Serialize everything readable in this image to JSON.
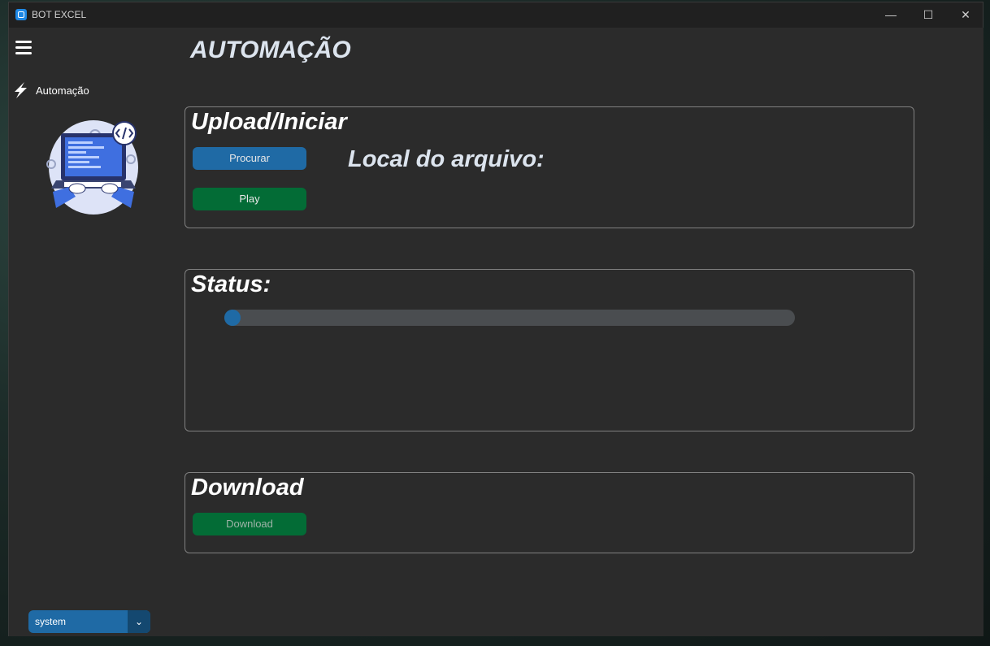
{
  "window": {
    "title": "BOT EXCEL",
    "controls": {
      "minimize": "—",
      "maximize": "☐",
      "close": "✕"
    }
  },
  "sidebar": {
    "menu_icon": "hamburger-menu-icon",
    "items": [
      {
        "label": "Automação",
        "icon": "lightning-bolt-icon"
      }
    ],
    "illustration": "developer-laptop-illustration",
    "theme_select": {
      "value": "system",
      "arrow": "⌄"
    }
  },
  "main": {
    "title": "AUTOMAÇÃO",
    "upload_panel": {
      "title": "Upload/Iniciar",
      "browse_button": "Procurar",
      "play_button": "Play",
      "file_location_label": "Local do arquivo:"
    },
    "status_panel": {
      "title": "Status:",
      "progress": 0
    },
    "download_panel": {
      "title": "Download",
      "download_button": "Download"
    }
  },
  "colors": {
    "accent_blue": "#1f6aa5",
    "accent_green": "#036c36",
    "background": "#2b2b2b",
    "titlebar": "#202020"
  }
}
